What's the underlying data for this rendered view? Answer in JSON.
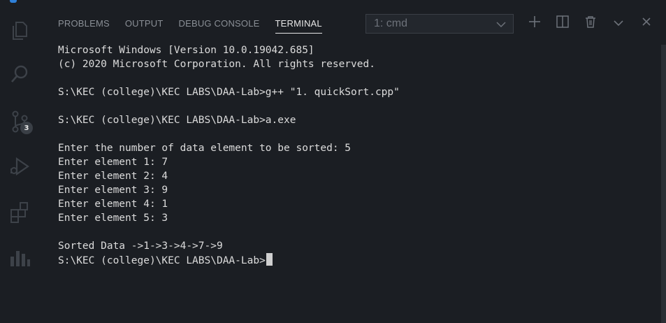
{
  "panel": {
    "tabs": [
      {
        "label": "PROBLEMS"
      },
      {
        "label": "OUTPUT"
      },
      {
        "label": "DEBUG CONSOLE"
      },
      {
        "label": "TERMINAL",
        "active": true
      }
    ],
    "terminal_select": "1: cmd",
    "actions": [
      "plus-icon",
      "split-icon",
      "trash-icon",
      "chevron-down-icon",
      "close-icon"
    ]
  },
  "activity_bar": {
    "items": [
      "explorer-icon",
      "search-icon",
      "source-control-icon",
      "run-debug-icon",
      "extensions-icon",
      "stats-icon"
    ],
    "source_control_badge": "3"
  },
  "terminal": {
    "lines": [
      "Microsoft Windows [Version 10.0.19042.685]",
      "(c) 2020 Microsoft Corporation. All rights reserved.",
      "",
      "S:\\KEC (college)\\KEC LABS\\DAA-Lab>g++ \"1. quickSort.cpp\"",
      "",
      "S:\\KEC (college)\\KEC LABS\\DAA-Lab>a.exe",
      "",
      "Enter the number of data element to be sorted: 5",
      "Enter element 1: 7",
      "Enter element 2: 4",
      "Enter element 3: 9",
      "Enter element 4: 1",
      "Enter element 5: 3",
      "",
      "Sorted Data ->1->3->4->7->9",
      "S:\\KEC (college)\\KEC LABS\\DAA-Lab>"
    ]
  },
  "colors": {
    "background": "#1b1e23",
    "text": "#dcdcdc",
    "tab_inactive": "#8a8f96",
    "tab_active": "#e7e7e7",
    "icon": "#3d4249"
  }
}
